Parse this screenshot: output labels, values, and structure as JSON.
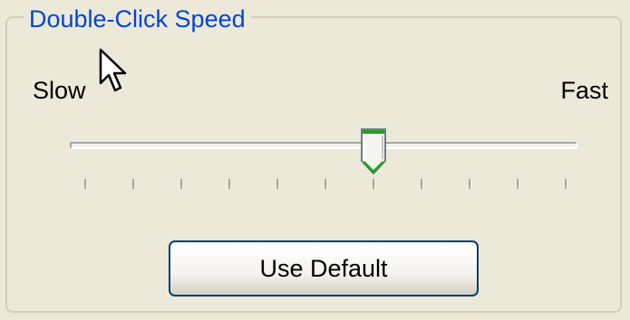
{
  "group": {
    "title": "Double-Click Speed"
  },
  "slider": {
    "min_label": "Slow",
    "max_label": "Fast",
    "tick_count": 11,
    "position_index": 6,
    "value_fraction": 0.6,
    "thumb_accent_color": "#21a121"
  },
  "button": {
    "label": "Use Default"
  },
  "cursor_icon": "arrow-pointer-icon"
}
